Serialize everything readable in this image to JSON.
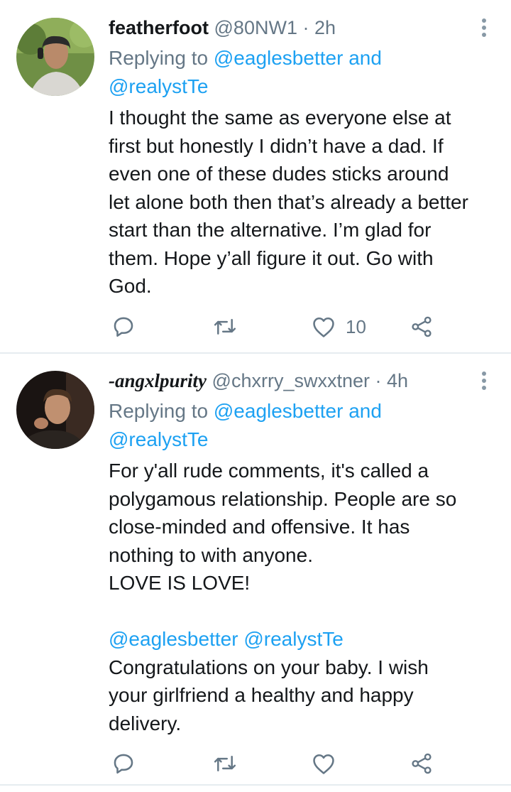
{
  "tweets": [
    {
      "display_name": "featherfoot",
      "handle": "@80NW1",
      "separator": "·",
      "time": "2h",
      "replying_prefix": "Replying to",
      "reply_to_1": "@eaglesbetter",
      "reply_and": "and",
      "reply_to_2": "@realystTe",
      "body_lines": [
        "I thought the same as everyone else at",
        "first but honestly I didn’t have a dad. If",
        "even one of these dudes sticks around",
        "let alone both then that’s already a better",
        "start than the alternative. I’m glad for",
        "them. Hope y’all figure it out. Go with",
        "God."
      ],
      "like_count": "10",
      "icons": [
        "reply-icon",
        "retweet-icon",
        "like-icon",
        "share-icon",
        "more-options-icon"
      ]
    },
    {
      "display_name": "-angxlpurity",
      "handle": "@chxrry_swxxtner",
      "separator": "·",
      "time": "4h",
      "replying_prefix": "Replying to",
      "reply_to_1": "@eaglesbetter",
      "reply_and": "and",
      "reply_to_2": "@realystTe",
      "body_lines": [
        "For y'all rude comments, it's called a",
        "polygamous relationship. People are so",
        "close-minded and offensive. It has",
        "nothing to with anyone.",
        "LOVE IS LOVE!"
      ],
      "mention_1": "@eaglesbetter",
      "mention_2": "@realystTe",
      "body_lines_2": [
        "Congratulations on your baby. I wish",
        "your girlfriend a healthy and happy",
        "delivery."
      ],
      "icons": [
        "reply-icon",
        "retweet-icon",
        "like-icon",
        "share-icon",
        "more-options-icon"
      ]
    }
  ],
  "colors": {
    "link": "#1da1f2",
    "secondary_text": "#657786",
    "primary_text": "#14171a",
    "icon": "#657786",
    "divider": "#e6ecf0"
  }
}
